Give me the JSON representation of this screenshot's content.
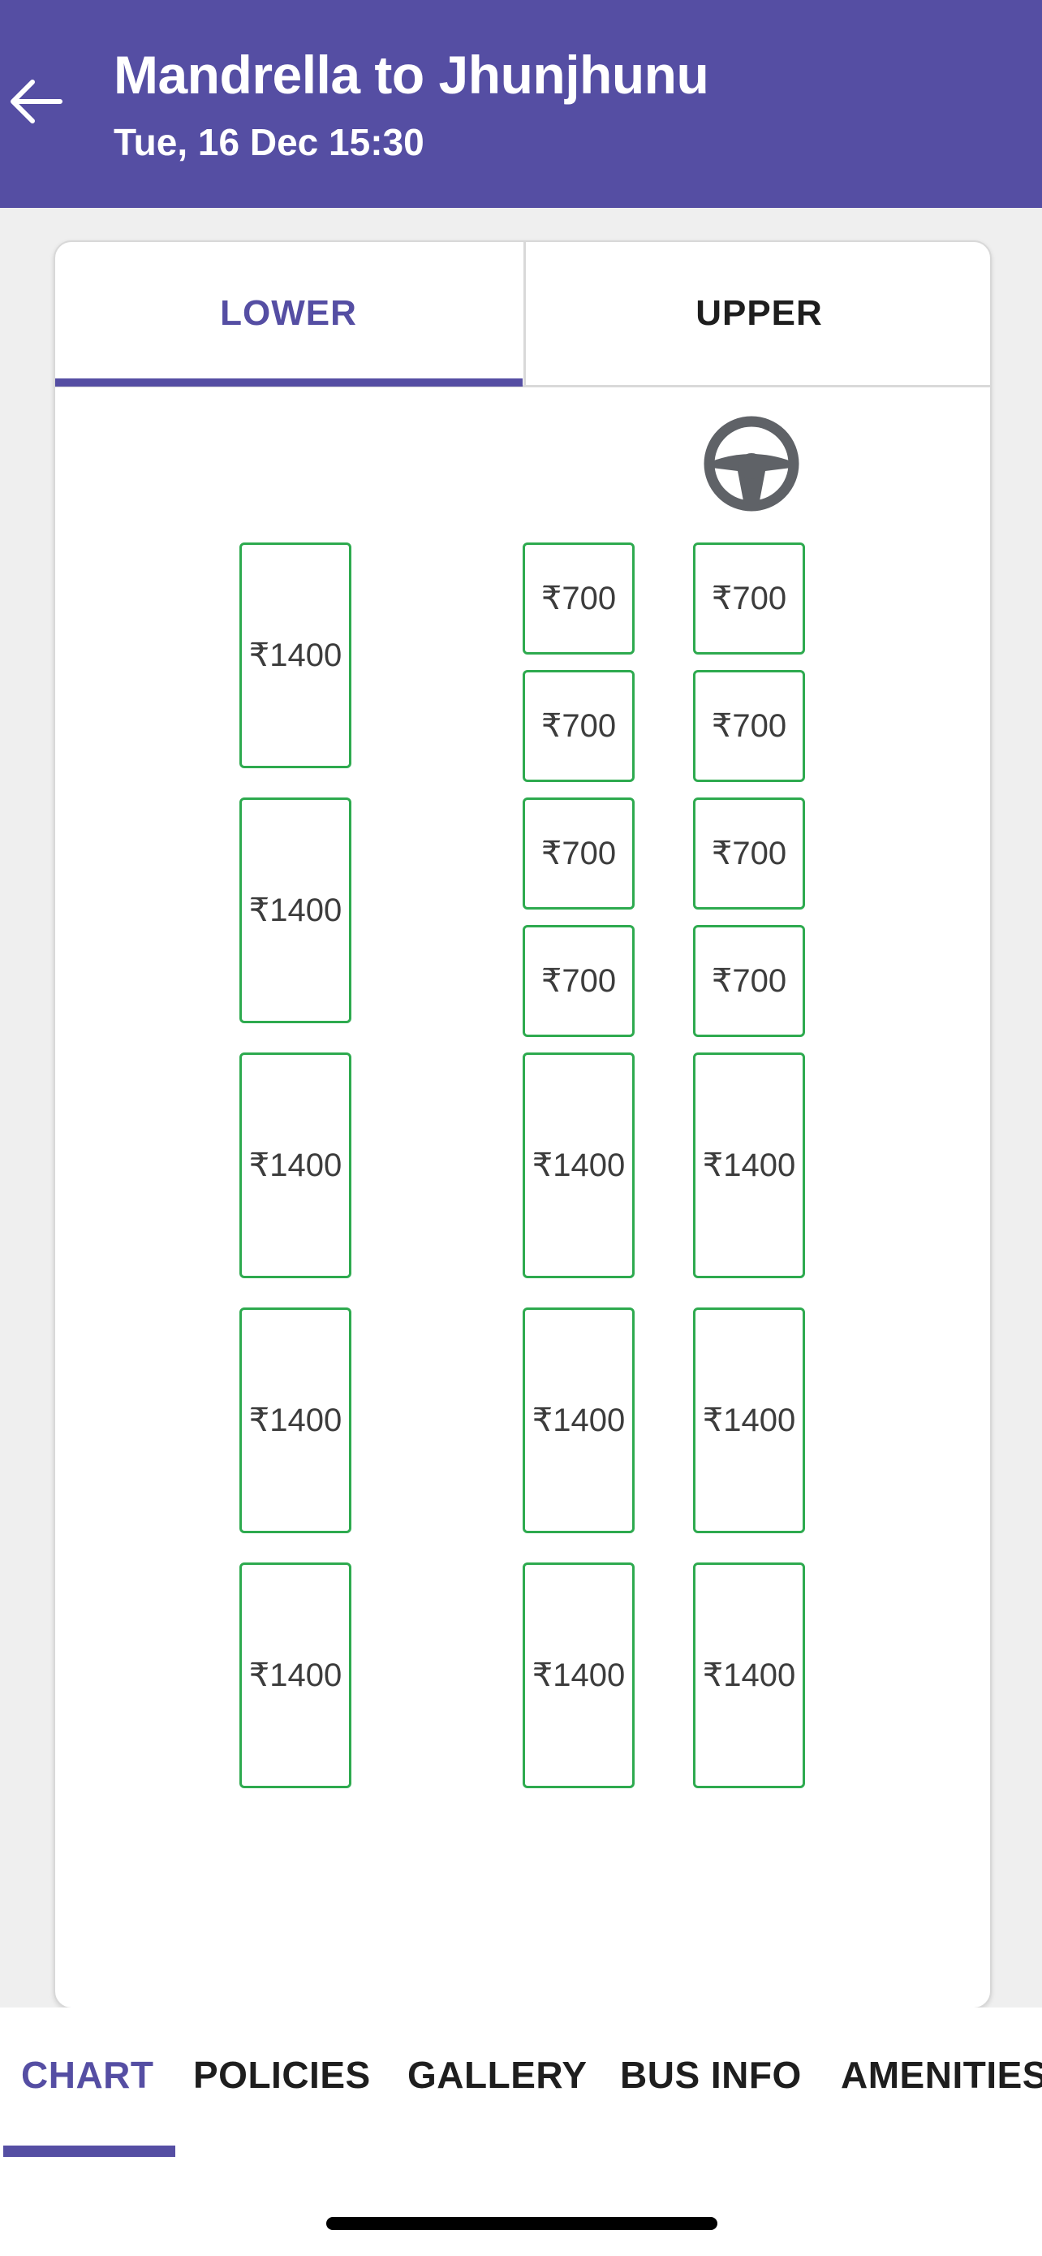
{
  "header": {
    "title": "Mandrella to Jhunjhunu",
    "subtitle": "Tue, 16 Dec 15:30",
    "back_icon": "arrow-left-icon",
    "background_color": "#554ea3"
  },
  "deck_tabs": [
    {
      "label": "LOWER",
      "active": true
    },
    {
      "label": "UPPER",
      "active": false
    }
  ],
  "driver_icon": "steering-wheel-icon",
  "seats": {
    "left_column": [
      {
        "price": "₹1400",
        "type": "sleeper"
      },
      {
        "price": "₹1400",
        "type": "sleeper"
      },
      {
        "price": "₹1400",
        "type": "sleeper"
      },
      {
        "price": "₹1400",
        "type": "sleeper"
      },
      {
        "price": "₹1400",
        "type": "sleeper"
      }
    ],
    "middle_column": [
      {
        "price": "₹700",
        "type": "seater"
      },
      {
        "price": "₹700",
        "type": "seater"
      },
      {
        "price": "₹700",
        "type": "seater"
      },
      {
        "price": "₹700",
        "type": "seater"
      },
      {
        "price": "₹1400",
        "type": "sleeper"
      },
      {
        "price": "₹1400",
        "type": "sleeper"
      },
      {
        "price": "₹1400",
        "type": "sleeper"
      }
    ],
    "right_column": [
      {
        "price": "₹700",
        "type": "seater"
      },
      {
        "price": "₹700",
        "type": "seater"
      },
      {
        "price": "₹700",
        "type": "seater"
      },
      {
        "price": "₹700",
        "type": "seater"
      },
      {
        "price": "₹1400",
        "type": "sleeper"
      },
      {
        "price": "₹1400",
        "type": "sleeper"
      },
      {
        "price": "₹1400",
        "type": "sleeper"
      }
    ],
    "available_border_color": "#2eaa4f"
  },
  "bottom_tabs": [
    {
      "label": "CHART",
      "active": true
    },
    {
      "label": "POLICIES",
      "active": false
    },
    {
      "label": "GALLERY",
      "active": false
    },
    {
      "label": "BUS INFO",
      "active": false
    },
    {
      "label": "AMENITIES",
      "active": false
    }
  ]
}
